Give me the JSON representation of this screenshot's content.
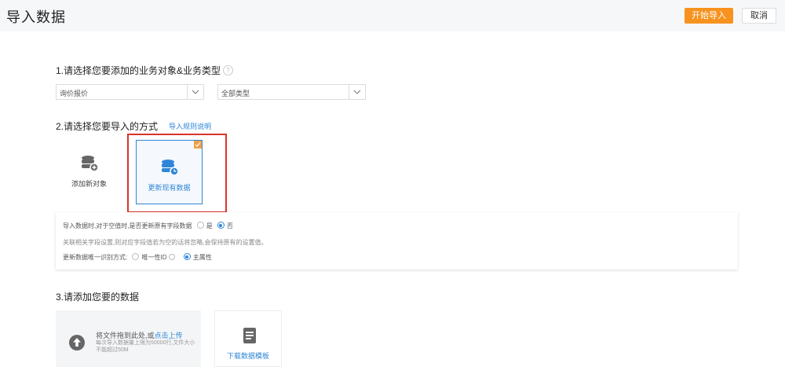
{
  "header": {
    "title": "导入数据",
    "start_import": "开始导入",
    "cancel": "取消"
  },
  "step1": {
    "label": "1.请选择您要添加的业务对象&业务类型",
    "object_select": "询价报价",
    "type_select": "全部类型"
  },
  "step2": {
    "label": "2.请选择您要导入的方式",
    "rules_link": "导入规则说明",
    "modes": [
      {
        "label": "添加新对象"
      },
      {
        "label": "更新现有数据"
      }
    ],
    "options": {
      "row1_text": "导入数据时,对于空值时,是否更新原有字段数据",
      "row1_yes": "是",
      "row1_no": "否",
      "row2_text": "关联相关字段设置,则对应字段值若为空的话将忽略,会保持原有的设置值。",
      "row3_text": "更新数据唯一识别方式:",
      "row3_opt_a": "唯一性ID",
      "row3_opt_b": "主属性"
    }
  },
  "step3": {
    "label": "3.请添加您要的数据",
    "upload_prefix": "将文件拖到此处,或",
    "upload_link": "点击上传",
    "upload_hint": "每次导入数据量上限为50000行,文件大小不能超过50M",
    "template_label": "下载数据模板"
  },
  "colors": {
    "accent": "#f7921e",
    "link": "#2f86d6",
    "highlight": "#d9342b"
  },
  "icons": [
    "database-add-icon",
    "database-refresh-icon",
    "upload-icon",
    "template-doc-icon",
    "check-icon",
    "chevron-down-icon"
  ]
}
